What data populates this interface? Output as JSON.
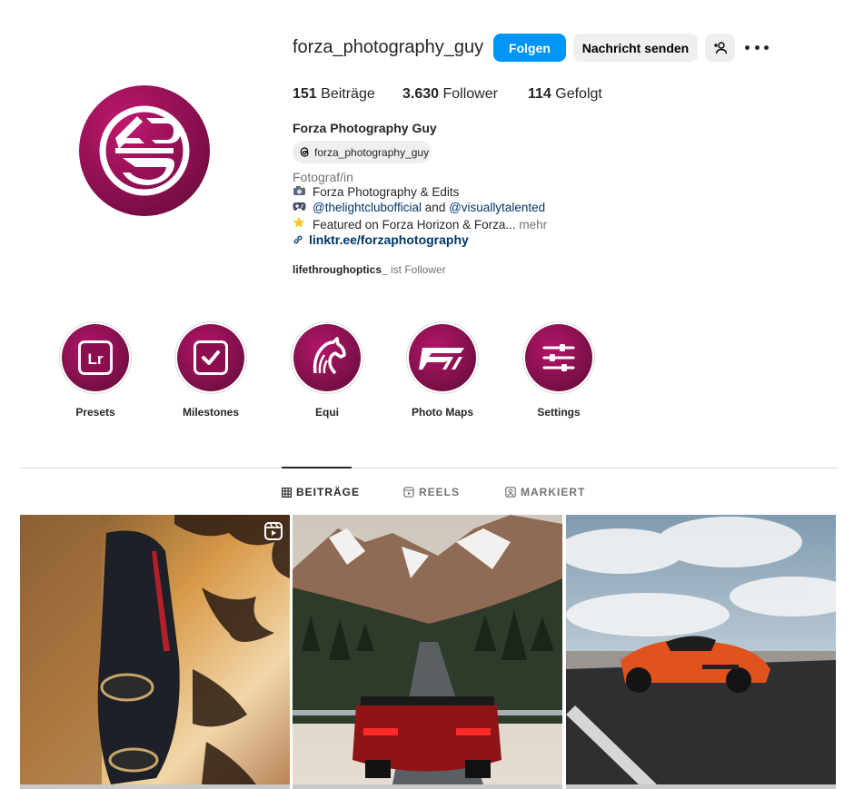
{
  "profile": {
    "username": "forza_photography_guy",
    "follow_label": "Folgen",
    "message_label": "Nachricht senden",
    "add_user_icon": "add-user-icon",
    "more_icon": "more-options-icon",
    "stats": [
      {
        "count": "151",
        "label": "Beiträge"
      },
      {
        "count": "3.630",
        "label": "Follower"
      },
      {
        "count": "114",
        "label": "Gefolgt"
      }
    ],
    "full_name": "Forza Photography Guy",
    "threads_handle": "forza_photography_guy",
    "category": "Fotograf/in",
    "bio": {
      "line1": "Forza Photography & Edits",
      "line2_mention1": "@thelightclubofficial",
      "line2_and": "and",
      "line2_mention2": "@visuallytalented",
      "line3": "Featured on Forza Horizon & Forza...",
      "line3_more": "mehr"
    },
    "link_text": "linktr.ee/forzaphotography",
    "followed_by_name": "lifethroughoptics_",
    "followed_by_text": "ist Follower",
    "brand_color": "#8b0f4f",
    "accent_color": "#0095f6"
  },
  "highlights": [
    {
      "label": "Presets",
      "icon": "lightroom-icon"
    },
    {
      "label": "Milestones",
      "icon": "checkbox-icon"
    },
    {
      "label": "Equi",
      "icon": "horse-icon"
    },
    {
      "label": "Photo Maps",
      "icon": "forza-logo-icon"
    },
    {
      "label": "Settings",
      "icon": "sliders-icon"
    }
  ],
  "tabs": [
    {
      "label": "BEITRÄGE",
      "icon": "grid-icon",
      "active": true
    },
    {
      "label": "REELS",
      "icon": "reels-icon",
      "active": false
    },
    {
      "label": "MARKIERT",
      "icon": "tagged-icon",
      "active": false
    }
  ],
  "posts": [
    {
      "subject": "dark sports car under palm trees at sunset",
      "is_reel": true
    },
    {
      "subject": "red sports car on mountain road with snowy peaks",
      "is_reel": false
    },
    {
      "subject": "orange corvette on road under cloudy sky",
      "is_reel": false
    }
  ]
}
